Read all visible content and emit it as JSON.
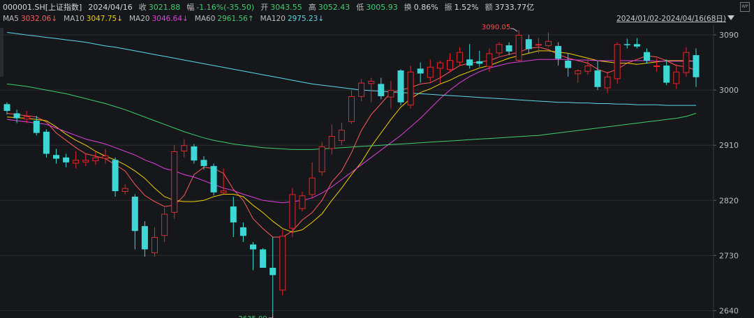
{
  "header": {
    "code": "000001.SH[上证指数]",
    "date": "2024/04/16",
    "close_label": "收",
    "close": "3021.88",
    "change_label": "幅",
    "change": "-1.16%(-35.50)",
    "open_label": "开",
    "open": "3043.55",
    "high_label": "高",
    "high": "3052.43",
    "low_label": "低",
    "low": "3005.93",
    "turnover_label": "换",
    "turnover": "0.86%",
    "amplitude_label": "振",
    "amplitude": "1.52%",
    "amount_label": "额",
    "amount": "3733.77亿"
  },
  "ma_legend": [
    {
      "name": "MA5",
      "value": "3032.06↓",
      "color": "#ff5a5a"
    },
    {
      "name": "MA10",
      "value": "3047.75↓",
      "color": "#f0d000"
    },
    {
      "name": "MA20",
      "value": "3046.64↓",
      "color": "#e040e0"
    },
    {
      "name": "MA60",
      "value": "2961.56↑",
      "color": "#3fcf6e"
    },
    {
      "name": "MA120",
      "value": "2975.23↓",
      "color": "#5ad8e8"
    }
  ],
  "range_label": "2024/01/02-2024/04/16(68日)",
  "watermark_icon": "wp-icon",
  "colors": {
    "up": "#e8262a",
    "down": "#3fd6d6",
    "bg": "#16171b",
    "grid": "#2b2c31"
  },
  "chart_data": {
    "type": "candlestick",
    "y_ticks": [
      3090,
      3000,
      2910,
      2820,
      2730,
      2640
    ],
    "ylim": [
      2628,
      3106
    ],
    "annotations": [
      {
        "text": "3090.05",
        "candle": 52
      },
      {
        "text": "2635.09",
        "candle": 27
      }
    ],
    "candles": [
      [
        2977,
        2966,
        2980,
        2960
      ],
      [
        2962,
        2954,
        2968,
        2946
      ],
      [
        2952,
        2957,
        2966,
        2946
      ],
      [
        2950,
        2930,
        2958,
        2926
      ],
      [
        2932,
        2896,
        2936,
        2890
      ],
      [
        2894,
        2888,
        2904,
        2880
      ],
      [
        2890,
        2882,
        2896,
        2874
      ],
      [
        2880,
        2886,
        2900,
        2872
      ],
      [
        2882,
        2886,
        2896,
        2876
      ],
      [
        2884,
        2890,
        2900,
        2878
      ],
      [
        2888,
        2893,
        2904,
        2880
      ],
      [
        2886,
        2835,
        2890,
        2826
      ],
      [
        2834,
        2840,
        2846,
        2830
      ],
      [
        2826,
        2770,
        2830,
        2740
      ],
      [
        2778,
        2740,
        2786,
        2728
      ],
      [
        2734,
        2760,
        2776,
        2728
      ],
      [
        2762,
        2798,
        2808,
        2752
      ],
      [
        2800,
        2900,
        2910,
        2790
      ],
      [
        2900,
        2910,
        2920,
        2890
      ],
      [
        2908,
        2885,
        2912,
        2880
      ],
      [
        2886,
        2876,
        2892,
        2870
      ],
      [
        2876,
        2833,
        2880,
        2828
      ],
      [
        2832,
        2836,
        2872,
        2830
      ],
      [
        2810,
        2784,
        2826,
        2760
      ],
      [
        2776,
        2762,
        2784,
        2752
      ],
      [
        2748,
        2740,
        2752,
        2706
      ],
      [
        2740,
        2710,
        2742,
        2710
      ],
      [
        2710,
        2698,
        2760,
        2635
      ],
      [
        2673,
        2762,
        2772,
        2665
      ],
      [
        2774,
        2830,
        2840,
        2760
      ],
      [
        2806,
        2828,
        2834,
        2802
      ],
      [
        2829,
        2857,
        2882,
        2823
      ],
      [
        2866,
        2908,
        2915,
        2860
      ],
      [
        2904,
        2925,
        2944,
        2895
      ],
      [
        2917,
        2935,
        2947,
        2910
      ],
      [
        2948,
        2990,
        3000,
        2945
      ],
      [
        2989,
        3012,
        3018,
        2982
      ],
      [
        3010,
        3015,
        3020,
        2980
      ],
      [
        3010,
        2990,
        3020,
        2985
      ],
      [
        2988,
        3000,
        3015,
        2970
      ],
      [
        3032,
        2980,
        3034,
        2975
      ],
      [
        2975,
        3030,
        3040,
        2970
      ],
      [
        3035,
        3027,
        3045,
        3012
      ],
      [
        3020,
        3038,
        3050,
        3014
      ],
      [
        3035,
        3045,
        3048,
        3010
      ],
      [
        3033,
        3049,
        3060,
        3030
      ],
      [
        3045,
        3062,
        3070,
        3040
      ],
      [
        3050,
        3040,
        3075,
        3035
      ],
      [
        3047,
        3043,
        3064,
        3038
      ],
      [
        3038,
        3060,
        3068,
        3030
      ],
      [
        3060,
        3075,
        3078,
        3056
      ],
      [
        3073,
        3063,
        3078,
        3057
      ],
      [
        3048,
        3090,
        3098,
        3046
      ],
      [
        3083,
        3067,
        3090,
        3060
      ],
      [
        3073,
        3075,
        3085,
        3060
      ],
      [
        3072,
        3080,
        3094,
        3070
      ],
      [
        3072,
        3051,
        3078,
        3040
      ],
      [
        3048,
        3036,
        3060,
        3022
      ],
      [
        3026,
        3032,
        3034,
        3012
      ],
      [
        3030,
        3040,
        3050,
        3025
      ],
      [
        3032,
        3005,
        3048,
        3000
      ],
      [
        3003,
        3022,
        3030,
        2995
      ],
      [
        3018,
        3075,
        3078,
        3010
      ],
      [
        3075,
        3074,
        3084,
        3068
      ],
      [
        3075,
        3071,
        3085,
        3068
      ],
      [
        3062,
        3048,
        3068,
        3043
      ],
      [
        3040,
        3040,
        3052,
        3030
      ],
      [
        3040,
        3012,
        3050,
        3008
      ],
      [
        3010,
        3030,
        3042,
        3002
      ],
      [
        3028,
        3062,
        3070,
        3022
      ],
      [
        3057,
        3021,
        3068,
        3005
      ]
    ],
    "ma": {
      "MA5": [
        2962,
        2960,
        2958,
        2956,
        2948,
        2930,
        2918,
        2906,
        2896,
        2892,
        2888,
        2878,
        2868,
        2846,
        2828,
        2818,
        2810,
        2812,
        2828,
        2862,
        2874,
        2872,
        2864,
        2838,
        2820,
        2790,
        2774,
        2760,
        2760,
        2770,
        2788,
        2800,
        2820,
        2850,
        2868,
        2898,
        2934,
        2960,
        2978,
        2996,
        3000,
        3004,
        3010,
        3012,
        3020,
        3030,
        3040,
        3044,
        3046,
        3048,
        3054,
        3058,
        3062,
        3068,
        3070,
        3066,
        3058,
        3052,
        3048,
        3044,
        3034,
        3028,
        3034,
        3044,
        3050,
        3056,
        3054,
        3048,
        3040,
        3038,
        3032
      ],
      "MA10": [
        2956,
        2955,
        2954,
        2952,
        2950,
        2940,
        2928,
        2918,
        2910,
        2900,
        2892,
        2886,
        2878,
        2868,
        2856,
        2840,
        2826,
        2820,
        2818,
        2818,
        2820,
        2826,
        2830,
        2830,
        2826,
        2812,
        2800,
        2786,
        2774,
        2768,
        2772,
        2784,
        2798,
        2820,
        2840,
        2862,
        2882,
        2908,
        2930,
        2952,
        2972,
        2986,
        2996,
        3002,
        3010,
        3016,
        3024,
        3030,
        3036,
        3040,
        3046,
        3052,
        3056,
        3060,
        3064,
        3064,
        3062,
        3060,
        3056,
        3052,
        3048,
        3046,
        3044,
        3044,
        3042,
        3044,
        3046,
        3048,
        3048,
        3048,
        3047
      ],
      "MA20": [
        2952,
        2950,
        2948,
        2946,
        2944,
        2938,
        2932,
        2926,
        2920,
        2916,
        2912,
        2906,
        2900,
        2894,
        2886,
        2880,
        2872,
        2868,
        2862,
        2858,
        2852,
        2846,
        2840,
        2836,
        2830,
        2825,
        2820,
        2818,
        2816,
        2818,
        2820,
        2824,
        2832,
        2842,
        2854,
        2866,
        2878,
        2890,
        2902,
        2914,
        2926,
        2940,
        2954,
        2970,
        2986,
        3000,
        3012,
        3022,
        3030,
        3036,
        3040,
        3044,
        3046,
        3048,
        3050,
        3050,
        3050,
        3050,
        3049,
        3049,
        3048,
        3048,
        3048,
        3048,
        3048,
        3048,
        3047,
        3047,
        3047,
        3047,
        3047
      ],
      "MA60": [
        3010,
        3008,
        3006,
        3003,
        3000,
        2997,
        2994,
        2990,
        2986,
        2982,
        2978,
        2973,
        2968,
        2962,
        2956,
        2950,
        2944,
        2938,
        2932,
        2927,
        2922,
        2918,
        2915,
        2912,
        2910,
        2908,
        2906,
        2905,
        2904,
        2903,
        2903,
        2903,
        2904,
        2905,
        2906,
        2907,
        2908,
        2909,
        2910,
        2911,
        2912,
        2913,
        2914,
        2915,
        2916,
        2917,
        2918,
        2919,
        2920,
        2921,
        2922,
        2923,
        2924,
        2925,
        2926,
        2928,
        2930,
        2932,
        2934,
        2936,
        2938,
        2940,
        2942,
        2944,
        2946,
        2948,
        2950,
        2952,
        2954,
        2957,
        2962
      ],
      "MA120": [
        3094,
        3092,
        3090,
        3088,
        3086,
        3084,
        3082,
        3080,
        3078,
        3075,
        3072,
        3070,
        3067,
        3064,
        3061,
        3058,
        3055,
        3052,
        3049,
        3046,
        3043,
        3040,
        3037,
        3034,
        3031,
        3028,
        3025,
        3022,
        3019,
        3016,
        3013,
        3010,
        3008,
        3006,
        3004,
        3002,
        3000,
        2999,
        2998,
        2997,
        2996,
        2995,
        2994,
        2993,
        2992,
        2991,
        2990,
        2989,
        2988,
        2987,
        2986,
        2985,
        2984,
        2983,
        2982,
        2981,
        2980,
        2980,
        2979,
        2979,
        2978,
        2978,
        2977,
        2977,
        2976,
        2976,
        2976,
        2975,
        2975,
        2975,
        2975
      ]
    }
  }
}
